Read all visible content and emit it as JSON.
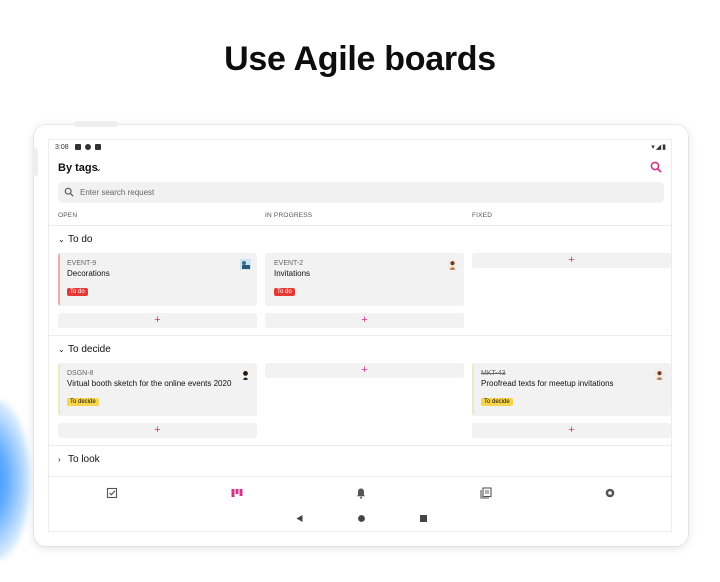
{
  "headline": "Use Agile boards",
  "status_bar": {
    "time": "3:08",
    "right_icons": "▾◢▮"
  },
  "toolbar": {
    "title": "By tags",
    "dropdown_icon": "chevron-down-icon",
    "search_icon": "search-icon"
  },
  "search": {
    "placeholder": "Enter search request",
    "value": ""
  },
  "columns": [
    "OPEN",
    "IN PROGRESS",
    "FIXED"
  ],
  "accent_color": "#d6338a",
  "groups": [
    {
      "name": "To do",
      "expanded": true,
      "cards": [
        {
          "column": "OPEN",
          "key": "EVENT-9",
          "title": "Decorations",
          "tag": "To do",
          "tag_color": "#e53935",
          "bar_color": "#f4a5b0"
        },
        {
          "column": "IN PROGRESS",
          "key": "EVENT-2",
          "title": "Invitations",
          "tag": "To do",
          "tag_color": "#e53935",
          "bar_color": "#f0f0f0"
        }
      ],
      "add_label": "+"
    },
    {
      "name": "To decide",
      "expanded": true,
      "cards": [
        {
          "column": "OPEN",
          "key": "DSGN-8",
          "title": "Virtual booth sketch for the online events 2020",
          "tag": "To decide",
          "tag_color": "#f7d44a",
          "bar_color": "#e8ecc2"
        },
        {
          "column": "FIXED",
          "key": "MKT-43",
          "title": "Proofread texts for meetup invitations",
          "tag": "To decide",
          "tag_color": "#f7d44a",
          "bar_color": "#e8ecc2"
        }
      ],
      "add_label": "+"
    },
    {
      "name": "To look",
      "expanded": false,
      "cards": []
    }
  ],
  "bottom_nav": [
    "tasks-icon",
    "agile-board-icon",
    "notifications-icon",
    "knowledge-base-icon",
    "settings-icon"
  ],
  "system_nav": [
    "back-icon",
    "home-icon",
    "recents-icon"
  ]
}
